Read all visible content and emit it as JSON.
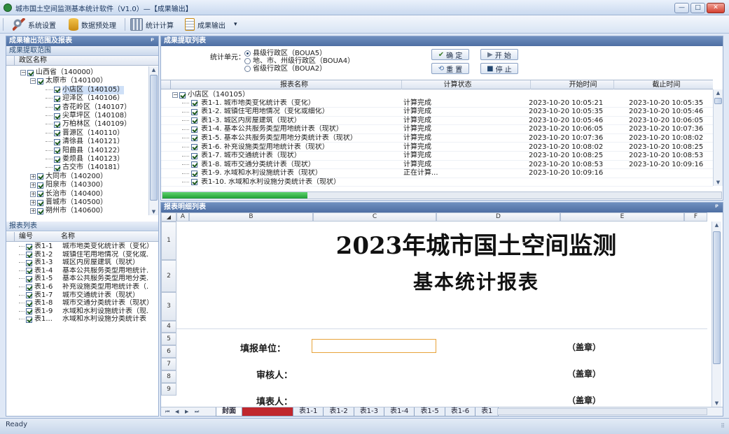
{
  "window": {
    "title": "城市国土空间监测基本统计软件（V1.0）—【成果输出】",
    "controls": {
      "minimize": "—",
      "maximize": "□",
      "close": "✕"
    }
  },
  "toolbar": {
    "items": [
      {
        "label": "系统设置",
        "icon": "settings-tools-icon"
      },
      {
        "label": "数据预处理",
        "icon": "database-icon"
      },
      {
        "label": "统计计算",
        "icon": "calculator-icon"
      },
      {
        "label": "成果输出",
        "icon": "report-icon"
      }
    ],
    "overflow": "▾"
  },
  "left_panel": {
    "title": "成果输出范围及报表",
    "pin": "ᵖ",
    "scope": {
      "title": "成果提取范围",
      "column": "政区名称",
      "tree": [
        {
          "label": "山西省（140000）",
          "level": 0,
          "expanded": true,
          "checked": true
        },
        {
          "label": "太原市（140100）",
          "level": 1,
          "expanded": true,
          "checked": true
        },
        {
          "label": "小店区（140105）",
          "level": 2,
          "checked": true
        },
        {
          "label": "迎泽区（140106）",
          "level": 2,
          "checked": true
        },
        {
          "label": "杏花岭区（140107）",
          "level": 2,
          "checked": true
        },
        {
          "label": "尖草坪区（140108）",
          "level": 2,
          "checked": true
        },
        {
          "label": "万柏林区（140109）",
          "level": 2,
          "checked": true
        },
        {
          "label": "晋源区（140110）",
          "level": 2,
          "checked": true
        },
        {
          "label": "清徐县（140121）",
          "level": 2,
          "checked": true
        },
        {
          "label": "阳曲县（140122）",
          "level": 2,
          "checked": true
        },
        {
          "label": "娄烦县（140123）",
          "level": 2,
          "checked": true
        },
        {
          "label": "古交市（140181）",
          "level": 2,
          "checked": true
        },
        {
          "label": "大同市（140200）",
          "level": 1,
          "expanded": false,
          "checked": true
        },
        {
          "label": "阳泉市（140300）",
          "level": 1,
          "expanded": false,
          "checked": true
        },
        {
          "label": "长治市（140400）",
          "level": 1,
          "expanded": false,
          "checked": true
        },
        {
          "label": "晋城市（140500）",
          "level": 1,
          "expanded": false,
          "checked": true
        },
        {
          "label": "朔州市（140600）",
          "level": 1,
          "expanded": false,
          "checked": true
        }
      ]
    },
    "reports": {
      "title": "报表列表",
      "columns": [
        "编号",
        "名称"
      ],
      "rows": [
        {
          "id": "表1-1",
          "name": "城市地类变化统计表（变化）"
        },
        {
          "id": "表1-2",
          "name": "城镇住宅用地情况（变化或..."
        },
        {
          "id": "表1-3",
          "name": "城区内房屋建筑（现状）"
        },
        {
          "id": "表1-4",
          "name": "基本公共服务类型用地统计..."
        },
        {
          "id": "表1-5",
          "name": "基本公共服务类型用地分类..."
        },
        {
          "id": "表1-6",
          "name": "补充设施类型用地统计表（..."
        },
        {
          "id": "表1-7",
          "name": "城市交通统计表（现状）"
        },
        {
          "id": "表1-8",
          "name": "城市交通分类统计表（现状）"
        },
        {
          "id": "表1-9",
          "name": "水域和水利设施统计表（现..."
        },
        {
          "id": "表1...",
          "name": "水域和水利设施分类统计表（..."
        }
      ]
    }
  },
  "extract_panel": {
    "title": "成果提取列表",
    "unit_label": "统计单元：",
    "options": [
      {
        "label": "县级行政区（BOUA5）",
        "selected": true
      },
      {
        "label": "地、市、州级行政区（BOUA4）",
        "selected": false
      },
      {
        "label": "省级行政区（BOUA2）",
        "selected": false
      }
    ],
    "buttons": {
      "confirm": "确 定",
      "reset": "重 置",
      "start": "开 始",
      "stop": "停 止"
    },
    "columns": [
      "报表名称",
      "计算状态",
      "开始时间",
      "截止时间"
    ],
    "group": "小店区（140105）",
    "rows": [
      {
        "name": "表1-1. 城市地类变化统计表（变化）",
        "status": "计算完成",
        "start": "2023-10-20 10:05:21",
        "end": "2023-10-20 10:05:35"
      },
      {
        "name": "表1-2. 城镇住宅用地情况（变化或细化）",
        "status": "计算完成",
        "start": "2023-10-20 10:05:35",
        "end": "2023-10-20 10:05:46"
      },
      {
        "name": "表1-3. 城区内房屋建筑（现状）",
        "status": "计算完成",
        "start": "2023-10-20 10:05:46",
        "end": "2023-10-20 10:06:05"
      },
      {
        "name": "表1-4. 基本公共服务类型用地统计表（现状）",
        "status": "计算完成",
        "start": "2023-10-20 10:06:05",
        "end": "2023-10-20 10:07:36"
      },
      {
        "name": "表1-5. 基本公共服务类型用地分类统计表（现状）",
        "status": "计算完成",
        "start": "2023-10-20 10:07:36",
        "end": "2023-10-20 10:08:02"
      },
      {
        "name": "表1-6. 补充设施类型用地统计表（现状）",
        "status": "计算完成",
        "start": "2023-10-20 10:08:02",
        "end": "2023-10-20 10:08:25"
      },
      {
        "name": "表1-7. 城市交通统计表（现状）",
        "status": "计算完成",
        "start": "2023-10-20 10:08:25",
        "end": "2023-10-20 10:08:53"
      },
      {
        "name": "表1-8. 城市交通分类统计表（现状）",
        "status": "计算完成",
        "start": "2023-10-20 10:08:53",
        "end": "2023-10-20 10:09:16"
      },
      {
        "name": "表1-9. 水域和水利设施统计表（现状）",
        "status": "正在计算...",
        "start": "2023-10-20 10:09:16",
        "end": ""
      },
      {
        "name": "表1-10. 水域和水利设施分类统计表（现状）",
        "status": "",
        "start": "",
        "end": ""
      }
    ],
    "progress": 0.26
  },
  "sheet_panel": {
    "title": "报表明细列表",
    "pin": "ᵖ",
    "corner": "◢",
    "col_headers": [
      "A",
      "B",
      "C",
      "D",
      "E",
      "F"
    ],
    "row_headers": [
      "1",
      "2",
      "3",
      "4",
      "5",
      "6",
      "7",
      "8",
      "9"
    ],
    "title_line1": "2023年城市国土空间监测",
    "title_line2": "基本统计报表",
    "fill_unit": "填报单位：",
    "reviewer": "审核人：",
    "filler": "填表人：",
    "seal": "（盖章）",
    "tabs": [
      "封面",
      "",
      "表1-1",
      "表1-2",
      "表1-3",
      "表1-4",
      "表1-5",
      "表1-6",
      "表1"
    ],
    "nav": [
      "⏮",
      "◀",
      "▶",
      "⏭"
    ]
  },
  "status": {
    "text": "Ready"
  },
  "colors": {
    "accent": "#4e6fa3",
    "progress": "#22a83a",
    "tab_active": "#c0272d",
    "selection_border": "#e8a33a"
  }
}
